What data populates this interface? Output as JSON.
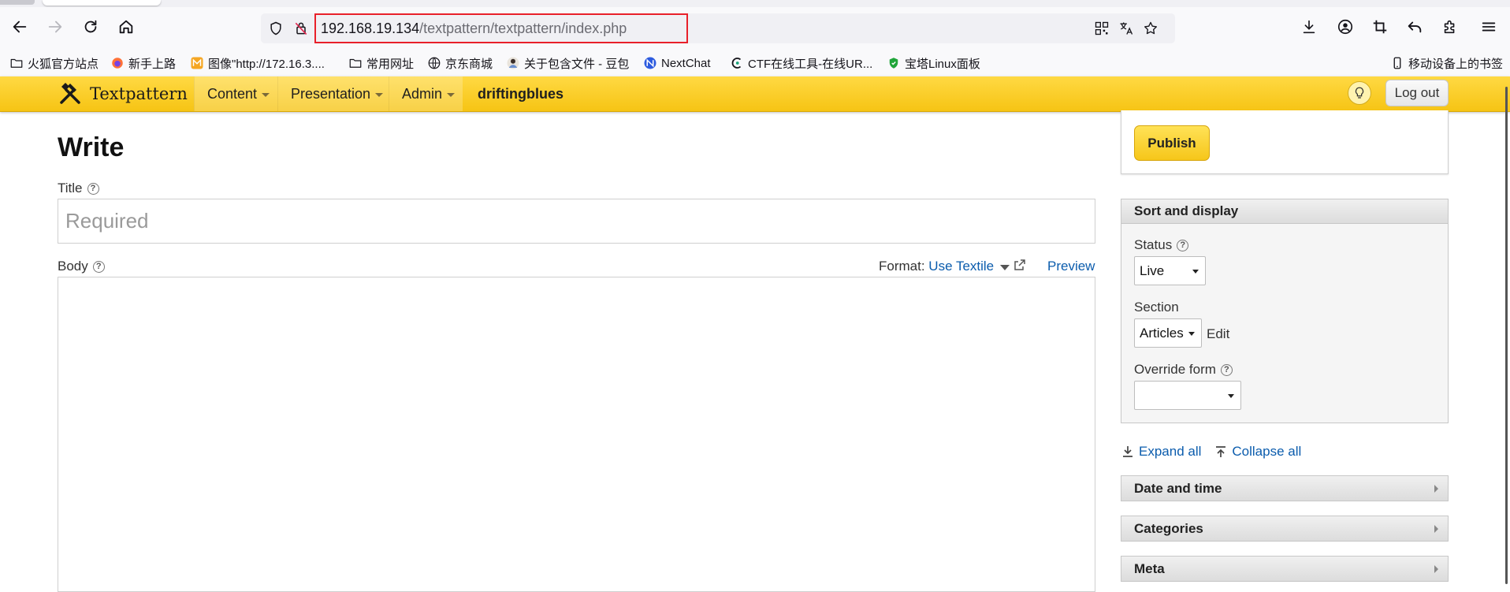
{
  "browser": {
    "url_host": "192.168.19.134",
    "url_path": "/textpattern/textpattern/index.php",
    "bookmarks": [
      {
        "label": "火狐官方站点",
        "icon": "folder-icon"
      },
      {
        "label": "新手上路",
        "icon": "firefox-icon"
      },
      {
        "label": "图像\"http://172.16.3....",
        "icon": "m-badge-icon"
      },
      {
        "label": "常用网址",
        "icon": "folder-icon"
      },
      {
        "label": "京东商城",
        "icon": "globe-icon"
      },
      {
        "label": "关于包含文件 - 豆包",
        "icon": "avatar-icon"
      },
      {
        "label": "NextChat",
        "icon": "nextchat-icon"
      },
      {
        "label": "CTF在线工具-在线UR...",
        "icon": "ctf-icon"
      },
      {
        "label": "宝塔Linux面板",
        "icon": "shield-green-icon"
      }
    ],
    "mobile_bookmarks": "移动设备上的书签"
  },
  "txp": {
    "logo": "Textpattern",
    "menu": {
      "content": "Content",
      "presentation": "Presentation",
      "admin": "Admin",
      "site": "driftingblues"
    },
    "logout": "Log out"
  },
  "write": {
    "heading": "Write",
    "title_label": "Title",
    "title_placeholder": "Required",
    "body_label": "Body",
    "format_label": "Format:",
    "format_value": "Use Textile",
    "preview": "Preview"
  },
  "sidebar": {
    "publish": "Publish",
    "sort_display": "Sort and display",
    "status_label": "Status",
    "status_value": "Live",
    "section_label": "Section",
    "section_value": "Articles",
    "section_edit": "Edit",
    "override_label": "Override form",
    "override_value": "",
    "expand_all": "Expand all",
    "collapse_all": "Collapse all",
    "panels": [
      "Date and time",
      "Categories",
      "Meta"
    ]
  },
  "colors": {
    "header_yellow": "#f9cd2b",
    "link_blue": "#0b5cad",
    "url_highlight": "#e8202a"
  }
}
